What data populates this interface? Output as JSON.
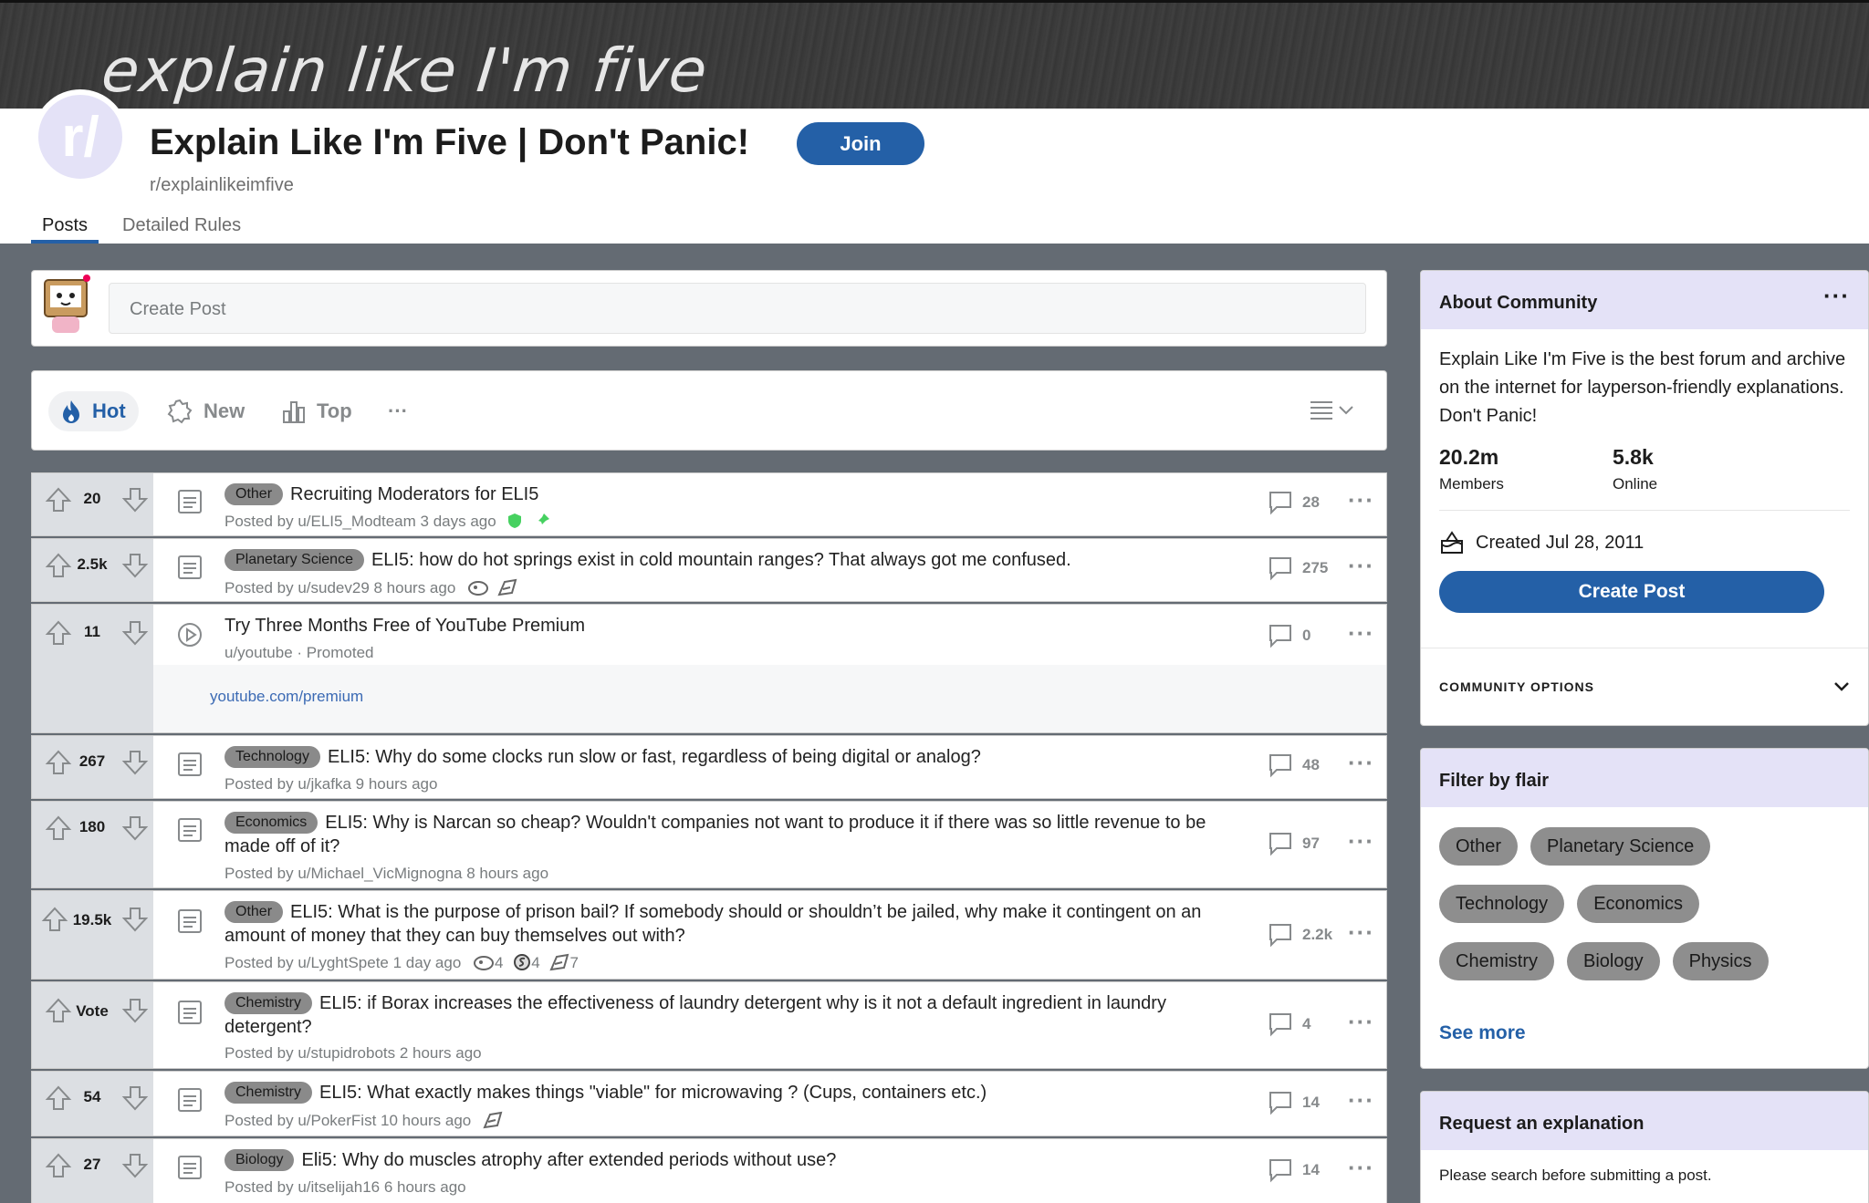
{
  "banner": {
    "text": "explain like I'm five"
  },
  "header": {
    "avatar_text": "r/",
    "title": "Explain Like I'm Five | Don't Panic!",
    "join_label": "Join",
    "subreddit": "r/explainlikeimfive",
    "tabs": [
      {
        "label": "Posts",
        "active": true
      },
      {
        "label": "Detailed Rules",
        "active": false
      }
    ]
  },
  "create_post": {
    "placeholder": "Create Post"
  },
  "sort": {
    "hot": "Hot",
    "new": "New",
    "top": "Top",
    "more": "···"
  },
  "posts": [
    {
      "score": "20",
      "flair": "Other",
      "title": "Recruiting Moderators for ELI5",
      "meta": "Posted by u/ELI5_Modteam 3 days ago",
      "comments": "28",
      "type": "text",
      "mod_badges": true
    },
    {
      "score": "2.5k",
      "flair": "Planetary Science",
      "title": "ELI5: how do hot springs exist in cold mountain ranges? That always got me confused.",
      "meta": "Posted by u/sudev29 8 hours ago",
      "comments": "275",
      "type": "text",
      "awards": ""
    },
    {
      "score": "11",
      "flair": "",
      "title": "Try Three Months Free of YouTube Premium",
      "meta": "u/youtube · Promoted",
      "comments": "0",
      "type": "video",
      "promo_link": "youtube.com/premium"
    },
    {
      "score": "267",
      "flair": "Technology",
      "title": "ELI5: Why do some clocks run slow or fast, regardless of being digital or analog?",
      "meta": "Posted by u/jkafka 9 hours ago",
      "comments": "48",
      "type": "text"
    },
    {
      "score": "180",
      "flair": "Economics",
      "title": "ELI5: Why is Narcan so cheap? Wouldn't companies not want to produce it if there was so little revenue to be made off of it?",
      "meta": "Posted by u/Michael_VicMignogna 8 hours ago",
      "comments": "97",
      "type": "text"
    },
    {
      "score": "19.5k",
      "flair": "Other",
      "title": "ELI5: What is the purpose of prison bail? If somebody should or shouldn’t be jailed, why make it contingent on an amount of money that they can buy themselves out with?",
      "meta": "Posted by u/LyghtSpete 1 day ago",
      "comments": "2.2k",
      "type": "text",
      "award_counts": [
        "4",
        "4",
        "7"
      ]
    },
    {
      "score": "Vote",
      "flair": "Chemistry",
      "title": "ELI5: if Borax increases the effectiveness of laundry detergent why is it not a default ingredient in laundry detergent?",
      "meta": "Posted by u/stupidrobots 2 hours ago",
      "comments": "4",
      "type": "text"
    },
    {
      "score": "54",
      "flair": "Chemistry",
      "title": "ELI5: What exactly makes things \"viable\" for microwaving ? (Cups, containers etc.)",
      "meta": "Posted by u/PokerFist 10 hours ago",
      "comments": "14",
      "type": "text"
    },
    {
      "score": "27",
      "flair": "Biology",
      "title": "Eli5: Why do muscles atrophy after extended periods without use?",
      "meta": "Posted by u/itselijah16 6 hours ago",
      "comments": "14",
      "type": "text"
    }
  ],
  "sidebar": {
    "about": {
      "heading": "About Community",
      "more": "···",
      "description": "Explain Like I'm Five is the best forum and archive on the internet for layperson-friendly explanations. Don't Panic!",
      "members_num": "20.2m",
      "members_lbl": "Members",
      "online_num": "5.8k",
      "online_lbl": "Online",
      "created": "Created Jul 28, 2011",
      "create_post": "Create Post",
      "options": "COMMUNITY OPTIONS"
    },
    "filter": {
      "heading": "Filter by flair",
      "chips": [
        "Other",
        "Planetary Science",
        "Technology",
        "Economics",
        "Chemistry",
        "Biology",
        "Physics"
      ],
      "see_more": "See more"
    },
    "request": {
      "heading": "Request an explanation",
      "text": "Please search before submitting a post."
    }
  },
  "colors": {
    "accent": "#2460a7",
    "sidebar_head": "#e4e2f7",
    "page_bg": "#646b73"
  }
}
